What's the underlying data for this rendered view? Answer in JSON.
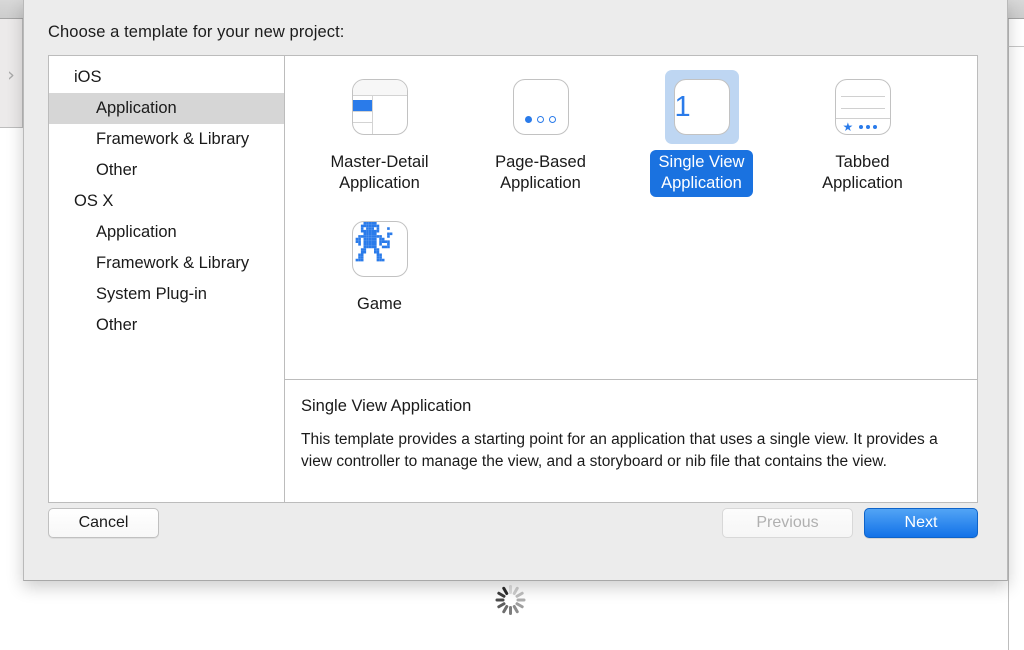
{
  "window": {
    "disclosure_icon": "chevron-right-icon",
    "spinner_icon": "progress-spinner-icon"
  },
  "sheet": {
    "prompt": "Choose a template for your new project:"
  },
  "sidebar": {
    "items": [
      {
        "label": "iOS",
        "level": "group",
        "selected": false
      },
      {
        "label": "Application",
        "level": "child",
        "selected": true
      },
      {
        "label": "Framework & Library",
        "level": "child",
        "selected": false
      },
      {
        "label": "Other",
        "level": "child",
        "selected": false
      },
      {
        "label": "OS X",
        "level": "group",
        "selected": false
      },
      {
        "label": "Application",
        "level": "child",
        "selected": false
      },
      {
        "label": "Framework & Library",
        "level": "child",
        "selected": false
      },
      {
        "label": "System Plug-in",
        "level": "child",
        "selected": false
      },
      {
        "label": "Other",
        "level": "child",
        "selected": false
      }
    ]
  },
  "templates": [
    {
      "label": "Master-Detail\nApplication",
      "icon": "master-detail-icon",
      "selected": false
    },
    {
      "label": "Page-Based\nApplication",
      "icon": "page-based-icon",
      "selected": false
    },
    {
      "label": "Single View\nApplication",
      "icon": "single-view-icon",
      "badge_number": "1",
      "selected": true
    },
    {
      "label": "Tabbed\nApplication",
      "icon": "tabbed-icon",
      "selected": false
    },
    {
      "label": "Game",
      "icon": "game-robot-icon",
      "selected": false
    }
  ],
  "description": {
    "title": "Single View Application",
    "body": "This template provides a starting point for an application that uses a single view. It provides a view controller to manage the view, and a storyboard or nib file that contains the view."
  },
  "footer": {
    "cancel_label": "Cancel",
    "previous_label": "Previous",
    "next_label": "Next"
  },
  "colors": {
    "selection_blue": "#1a72e0",
    "selection_halo": "#bed6f2",
    "icon_blue": "#2a7bea",
    "sheet_background": "#ececec",
    "sidebar_selected": "#d6d6d6"
  }
}
